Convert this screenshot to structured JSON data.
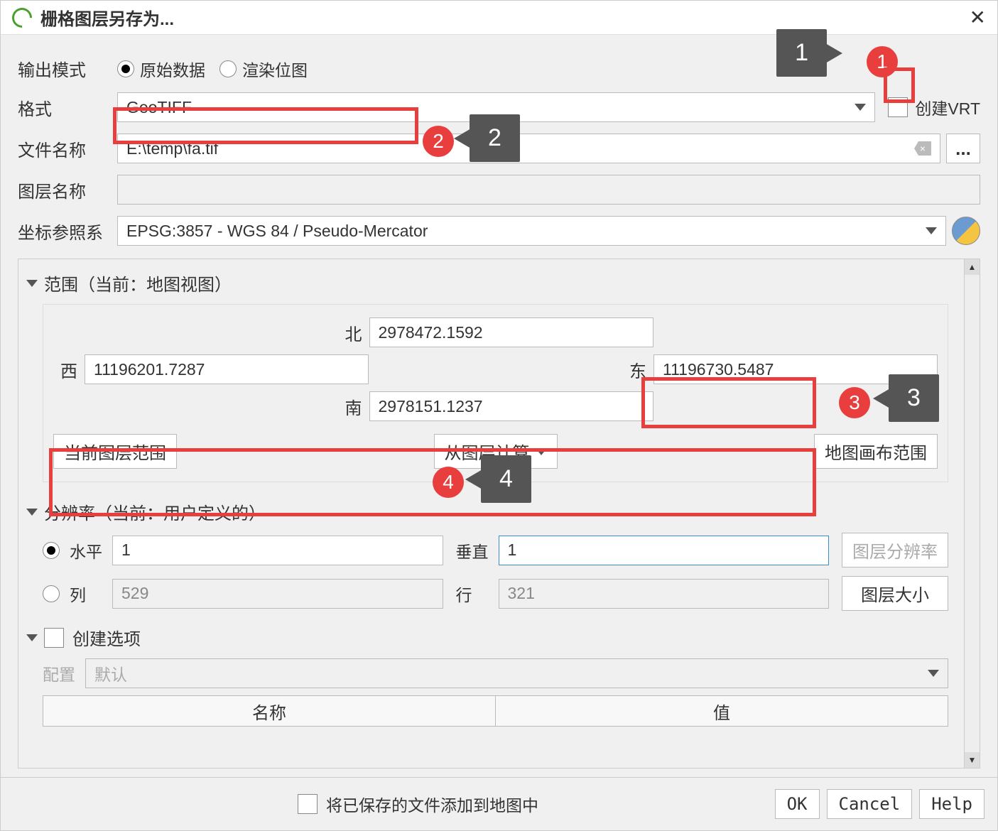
{
  "title": "栅格图层另存为...",
  "outputMode": {
    "label": "输出模式",
    "rawData": "原始数据",
    "rendered": "渲染位图"
  },
  "formatRow": {
    "label": "格式",
    "value": "GeoTIFF",
    "createVrt": "创建VRT"
  },
  "fileRow": {
    "label": "文件名称",
    "value": "E:\\temp\\fa.tif"
  },
  "layerRow": {
    "label": "图层名称",
    "value": ""
  },
  "crsRow": {
    "label": "坐标参照系",
    "value": "EPSG:3857 - WGS 84 / Pseudo-Mercator"
  },
  "extent": {
    "header": "范围（当前：地图视图）",
    "north": {
      "lbl": "北",
      "val": "2978472.1592"
    },
    "west": {
      "lbl": "西",
      "val": "11196201.7287"
    },
    "east": {
      "lbl": "东",
      "val": "11196730.5487"
    },
    "south": {
      "lbl": "南",
      "val": "2978151.1237"
    },
    "btnLayer": "当前图层范围",
    "btnCalc": "从图层计算",
    "btnCanvas": "地图画布范围"
  },
  "resolution": {
    "header": "分辨率（当前：用户定义的）",
    "horiz": {
      "lbl": "水平",
      "val": "1"
    },
    "vert": {
      "lbl": "垂直",
      "val": "1"
    },
    "cols": {
      "lbl": "列",
      "val": "529"
    },
    "rows": {
      "lbl": "行",
      "val": "321"
    },
    "btnRes": "图层分辨率",
    "btnSize": "图层大小"
  },
  "createOpts": {
    "header": "创建选项",
    "profileLbl": "配置",
    "profileVal": "默认",
    "colName": "名称",
    "colValue": "值"
  },
  "footer": {
    "addToMap": "将已保存的文件添加到地图中",
    "ok": "OK",
    "cancel": "Cancel",
    "help": "Help"
  },
  "anno": {
    "n1": "1",
    "n2": "2",
    "n3": "3",
    "n4": "4"
  }
}
